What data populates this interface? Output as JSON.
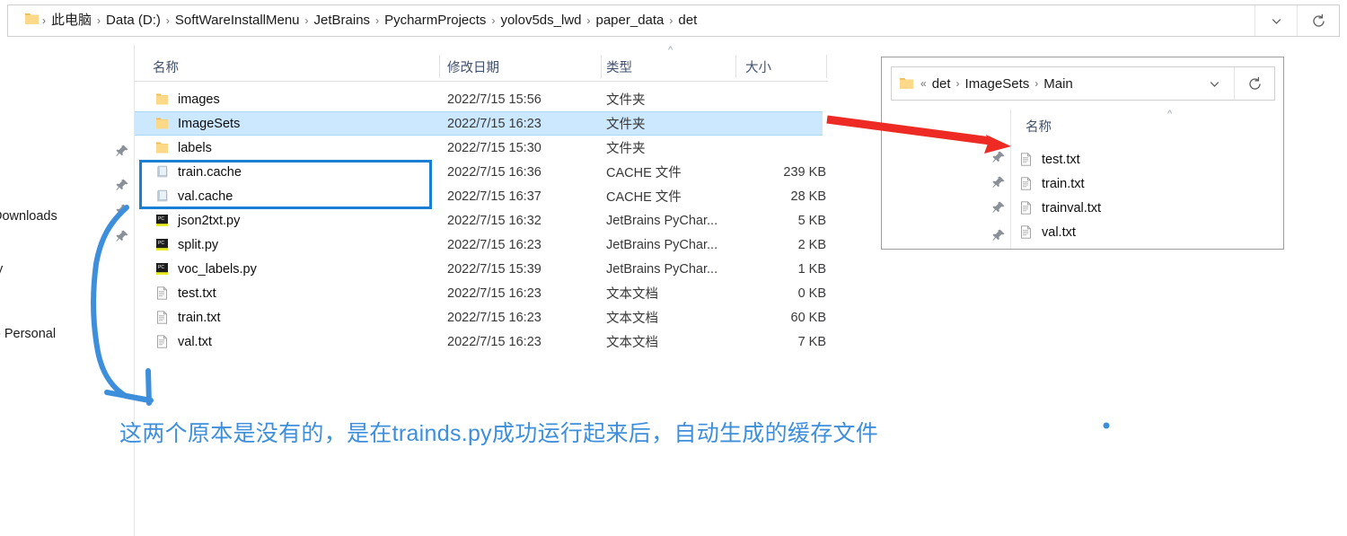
{
  "window": {
    "address_bar": {
      "folder_icon": "folder-icon",
      "crumbs": [
        "此电脑",
        "Data (D:)",
        "SoftWareInstallMenu",
        "JetBrains",
        "PycharmProjects",
        "yolov5ds_lwd",
        "paper_data",
        "det"
      ],
      "separator": "›",
      "chevron_icon": "chevron-down-icon",
      "refresh_icon": "refresh-icon"
    },
    "nav_pane": {
      "visible_labels": [
        "Downloads",
        "y",
        "- Personal"
      ],
      "pin_icon": "pin-icon",
      "pin_count": 4
    },
    "columns": {
      "name": "名称",
      "date_modified": "修改日期",
      "type": "类型",
      "size": "大小",
      "sort_indicator": "^",
      "sorted_by": "类型"
    },
    "files": [
      {
        "name": "images",
        "icon": "folder-icon",
        "date": "2022/7/15 15:56",
        "type": "文件夹",
        "size": "",
        "selected": false
      },
      {
        "name": "ImageSets",
        "icon": "folder-icon",
        "date": "2022/7/15 16:23",
        "type": "文件夹",
        "size": "",
        "selected": true
      },
      {
        "name": "labels",
        "icon": "folder-icon",
        "date": "2022/7/15 15:30",
        "type": "文件夹",
        "size": "",
        "selected": false
      },
      {
        "name": "train.cache",
        "icon": "cache-icon",
        "date": "2022/7/15 16:36",
        "type": "CACHE 文件",
        "size": "239 KB",
        "selected": false
      },
      {
        "name": "val.cache",
        "icon": "cache-icon",
        "date": "2022/7/15 16:37",
        "type": "CACHE 文件",
        "size": "28 KB",
        "selected": false
      },
      {
        "name": "json2txt.py",
        "icon": "pycharm-icon",
        "date": "2022/7/15 16:32",
        "type": "JetBrains PyChar...",
        "size": "5 KB",
        "selected": false
      },
      {
        "name": "split.py",
        "icon": "pycharm-icon",
        "date": "2022/7/15 16:23",
        "type": "JetBrains PyChar...",
        "size": "2 KB",
        "selected": false
      },
      {
        "name": "voc_labels.py",
        "icon": "pycharm-icon",
        "date": "2022/7/15 15:39",
        "type": "JetBrains PyChar...",
        "size": "1 KB",
        "selected": false
      },
      {
        "name": "test.txt",
        "icon": "text-icon",
        "date": "2022/7/15 16:23",
        "type": "文本文档",
        "size": "0 KB",
        "selected": false
      },
      {
        "name": "train.txt",
        "icon": "text-icon",
        "date": "2022/7/15 16:23",
        "type": "文本文档",
        "size": "60 KB",
        "selected": false
      },
      {
        "name": "val.txt",
        "icon": "text-icon",
        "date": "2022/7/15 16:23",
        "type": "文本文档",
        "size": "7 KB",
        "selected": false
      }
    ]
  },
  "inset_window": {
    "address_bar": {
      "folder_icon": "folder-icon",
      "overflow": "«",
      "crumbs": [
        "det",
        "ImageSets",
        "Main"
      ],
      "separator": "›",
      "chevron_icon": "chevron-down-icon",
      "refresh_icon": "refresh-icon"
    },
    "nav_pane": {
      "pin_icon": "pin-icon",
      "pin_count": 4
    },
    "columns": {
      "name": "名称",
      "sort_indicator": "^"
    },
    "files": [
      {
        "name": "test.txt",
        "icon": "text-icon"
      },
      {
        "name": "train.txt",
        "icon": "text-icon"
      },
      {
        "name": "trainval.txt",
        "icon": "text-icon"
      },
      {
        "name": "val.txt",
        "icon": "text-icon"
      }
    ]
  },
  "annotations": {
    "note_text": "这两个原本是没有的，是在trainds.py成功运行起来后，自动生成的缓存文件",
    "note_color": "#3d8fdc",
    "highlight_box_color": "#1a7fd4",
    "arrow_color": "#ee2a24",
    "curve_color": "#3d8fdc",
    "dot_color": "#3d8fdc"
  }
}
